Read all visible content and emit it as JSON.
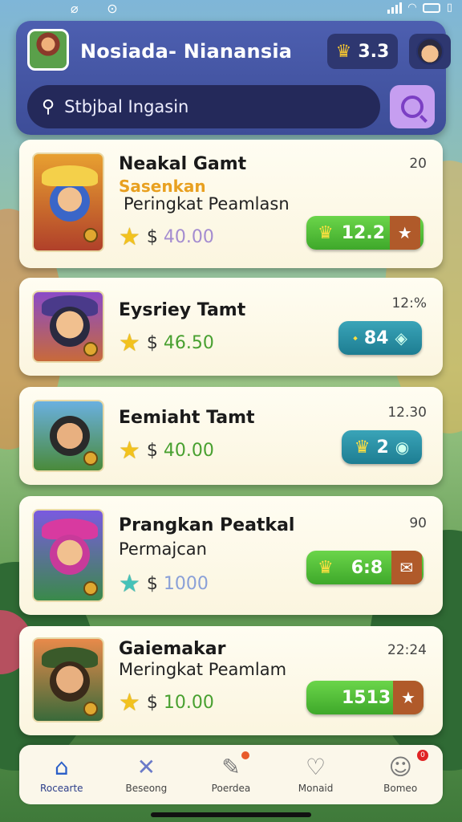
{
  "status_bar": {
    "battery_text": ""
  },
  "header": {
    "title": "Nosiada- Nianansia",
    "coins": "3.3",
    "search_placeholder": "Stbjbal Ingasin"
  },
  "cards": [
    {
      "title": "Neakal Gamt",
      "subtitle": "Sasenkan",
      "description": "Peringkat Peamlasn",
      "number": "20",
      "price_symbol": "$",
      "price": "40.00",
      "button_label": "12.2"
    },
    {
      "title": "Eysriey Tamt",
      "subtitle": "",
      "description": "",
      "number": "12:%",
      "price_symbol": "$",
      "price": "46.50",
      "button_label": "84"
    },
    {
      "title": "Eemiaht Tamt",
      "subtitle": "",
      "description": "",
      "number": "12.30",
      "price_symbol": "$",
      "price": "40.00",
      "button_label": "2"
    },
    {
      "title": "Prangkan Peatkal",
      "subtitle": "",
      "description": "Permajcan",
      "number": "90",
      "price_symbol": "$",
      "price": "1000",
      "button_label": "6:8"
    },
    {
      "title": "Gaiemakar",
      "subtitle": "",
      "description": "Meringkat Peamlam",
      "number": "22:24",
      "price_symbol": "$",
      "price": "10.00",
      "button_label": "1513"
    }
  ],
  "nav": [
    {
      "label": "Rocearte",
      "icon": "home-icon"
    },
    {
      "label": "Beseong",
      "icon": "tools-icon"
    },
    {
      "label": "Poerdea",
      "icon": "edit-icon"
    },
    {
      "label": "Monaid",
      "icon": "heart-icon"
    },
    {
      "label": "Bomeo",
      "icon": "profile-icon",
      "badge": "0"
    }
  ],
  "colors": {
    "accent": "#4d5fb0",
    "green": "#3ea82a",
    "teal": "#1d7d92",
    "gold": "#f2c21e"
  }
}
